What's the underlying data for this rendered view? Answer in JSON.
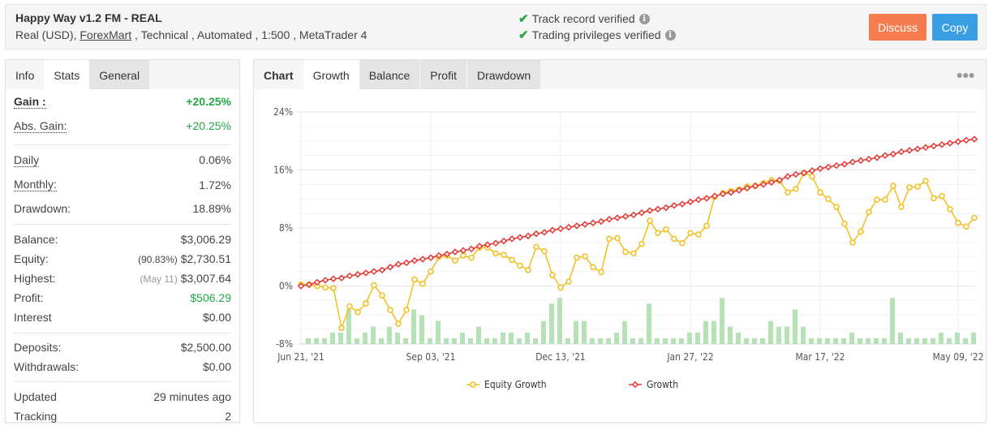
{
  "header": {
    "title": "Happy Way v1.2 FM - REAL",
    "subtitle_prefix": "Real (USD), ",
    "broker_link": "ForexMart",
    "subtitle_suffix": " , Technical , Automated , 1:500 , MetaTrader 4",
    "verified": [
      {
        "icon": "check-icon",
        "label": "Track record verified",
        "info_icon": "info-icon"
      },
      {
        "icon": "check-icon",
        "label": "Trading privileges verified",
        "info_icon": "info-icon"
      }
    ],
    "discuss_label": "Discuss",
    "copy_label": "Copy",
    "colors": {
      "discuss": "#f47c4e",
      "copy": "#3a9ee3",
      "verified": "#28a745"
    }
  },
  "left_panel": {
    "tabs": [
      {
        "label": "Info",
        "state": "default"
      },
      {
        "label": "Stats",
        "state": "active"
      },
      {
        "label": "General",
        "state": "inactive"
      }
    ],
    "gain": {
      "label": "Gain :",
      "value": "+20.25%"
    },
    "abs_gain": {
      "label": "Abs. Gain:",
      "value": "+20.25%"
    },
    "daily": {
      "label": "Daily",
      "value": "0.06%"
    },
    "monthly": {
      "label": "Monthly:",
      "value": "1.72%"
    },
    "drawdown": {
      "label": "Drawdown:",
      "value": "18.89%"
    },
    "balance": {
      "label": "Balance:",
      "value": "$3,006.29"
    },
    "equity": {
      "label": "Equity:",
      "note": "(90.83%)",
      "value": "$2,730.51"
    },
    "highest": {
      "label": "Highest:",
      "note": "(May 11)",
      "value": "$3,007.64"
    },
    "profit": {
      "label": "Profit:",
      "value": "$506.29"
    },
    "interest": {
      "label": "Interest",
      "value": "$0.00"
    },
    "deposits": {
      "label": "Deposits:",
      "value": "$2,500.00"
    },
    "withdrawals": {
      "label": "Withdrawals:",
      "value": "$0.00"
    },
    "updated": {
      "label": "Updated",
      "value": "29 minutes ago"
    },
    "tracking": {
      "label": "Tracking",
      "value": "2"
    }
  },
  "right_panel": {
    "tabs": [
      {
        "label": "Chart",
        "state": "default"
      },
      {
        "label": "Growth",
        "state": "active"
      },
      {
        "label": "Balance",
        "state": "inactive"
      },
      {
        "label": "Profit",
        "state": "inactive"
      },
      {
        "label": "Drawdown",
        "state": "inactive"
      }
    ],
    "more_icon": "more-dots-icon"
  },
  "chart_data": {
    "type": "line",
    "title": "",
    "xlabel": "",
    "ylabel": "",
    "ylim": [
      -8,
      24
    ],
    "yticks": [
      "24%",
      "16%",
      "8%",
      "0%",
      "-8%"
    ],
    "ytick_values": [
      24,
      16,
      8,
      0,
      -8
    ],
    "xtick_labels": [
      "Jun 21, '21",
      "Sep 03, '21",
      "Dec 13, '21",
      "Jan 27, '22",
      "Mar 17, '22",
      "May 09, '22"
    ],
    "xtick_indices": [
      0,
      16,
      32,
      48,
      64,
      81
    ],
    "grid": true,
    "legend": {
      "placement": "bottom-center",
      "entries": [
        {
          "name": "Equity Growth",
          "color": "#f5bd19",
          "marker": "circle"
        },
        {
          "name": "Growth",
          "color": "#e53935",
          "marker": "diamond"
        }
      ]
    },
    "series": [
      {
        "name": "Equity Growth",
        "color": "#f5bd19",
        "values": [
          0.2,
          0.2,
          0.0,
          -0.2,
          -0.3,
          -5.8,
          -2.8,
          -3.6,
          -2.4,
          0.1,
          -1.3,
          -3.3,
          -5.2,
          -3.3,
          0.9,
          0.3,
          2.0,
          4.0,
          4.2,
          3.5,
          4.2,
          3.9,
          5.3,
          5.3,
          4.5,
          4.3,
          3.6,
          2.8,
          2.2,
          5.4,
          4.8,
          1.5,
          -0.2,
          0.6,
          3.9,
          4.1,
          2.6,
          1.9,
          6.5,
          6.6,
          4.7,
          4.5,
          5.8,
          9.0,
          7.3,
          7.8,
          6.5,
          5.9,
          7.3,
          7.1,
          8.3,
          12.3,
          12.8,
          13.1,
          13.3,
          13.7,
          13.8,
          14.2,
          14.6,
          14.5,
          12.9,
          13.4,
          15.6,
          15.1,
          12.9,
          12.0,
          10.9,
          8.6,
          6.0,
          7.5,
          10.2,
          11.9,
          11.9,
          13.8,
          10.9,
          13.6,
          13.7,
          14.5,
          12.1,
          12.4,
          10.6,
          8.7,
          8.2,
          9.4
        ]
      },
      {
        "name": "Growth",
        "color": "#e53935",
        "values": [
          0.0,
          0.2,
          0.5,
          0.8,
          1.0,
          1.1,
          1.4,
          1.6,
          1.8,
          2.0,
          2.2,
          2.6,
          3.0,
          3.2,
          3.5,
          3.7,
          3.9,
          4.2,
          4.4,
          4.7,
          4.9,
          5.1,
          5.5,
          5.7,
          5.9,
          6.2,
          6.5,
          6.7,
          6.9,
          7.2,
          7.4,
          7.7,
          7.9,
          8.1,
          8.3,
          8.5,
          8.7,
          8.9,
          9.2,
          9.4,
          9.6,
          9.8,
          10.1,
          10.4,
          10.6,
          10.8,
          11.1,
          11.3,
          11.6,
          11.9,
          12.1,
          12.4,
          12.7,
          12.9,
          13.2,
          13.5,
          13.8,
          14.0,
          14.3,
          14.6,
          15.1,
          15.4,
          15.6,
          15.9,
          16.2,
          16.4,
          16.6,
          16.8,
          17.1,
          17.3,
          17.5,
          17.7,
          18.0,
          18.2,
          18.5,
          18.7,
          18.9,
          19.1,
          19.3,
          19.5,
          19.7,
          19.9,
          20.1,
          20.25
        ]
      }
    ],
    "bars": {
      "name": "Trades",
      "color": "#b5e3b5",
      "values": [
        1,
        1,
        1,
        2,
        2,
        6,
        1,
        2,
        3,
        1,
        3,
        2,
        1,
        6,
        5,
        1,
        4,
        1,
        1,
        2,
        1,
        3,
        1,
        1,
        2,
        2,
        1,
        2,
        1,
        4,
        7,
        8,
        1,
        4,
        4,
        1,
        1,
        1,
        2,
        4,
        1,
        1,
        7,
        1,
        1,
        1,
        1,
        2,
        2,
        4,
        4,
        8,
        3,
        2,
        1,
        1,
        1,
        4,
        3,
        3,
        6,
        3,
        1,
        1,
        1,
        1,
        1,
        2,
        1,
        1,
        1,
        1,
        8,
        2,
        1,
        1,
        1,
        1,
        2,
        1,
        2,
        1,
        2,
        2
      ]
    }
  }
}
